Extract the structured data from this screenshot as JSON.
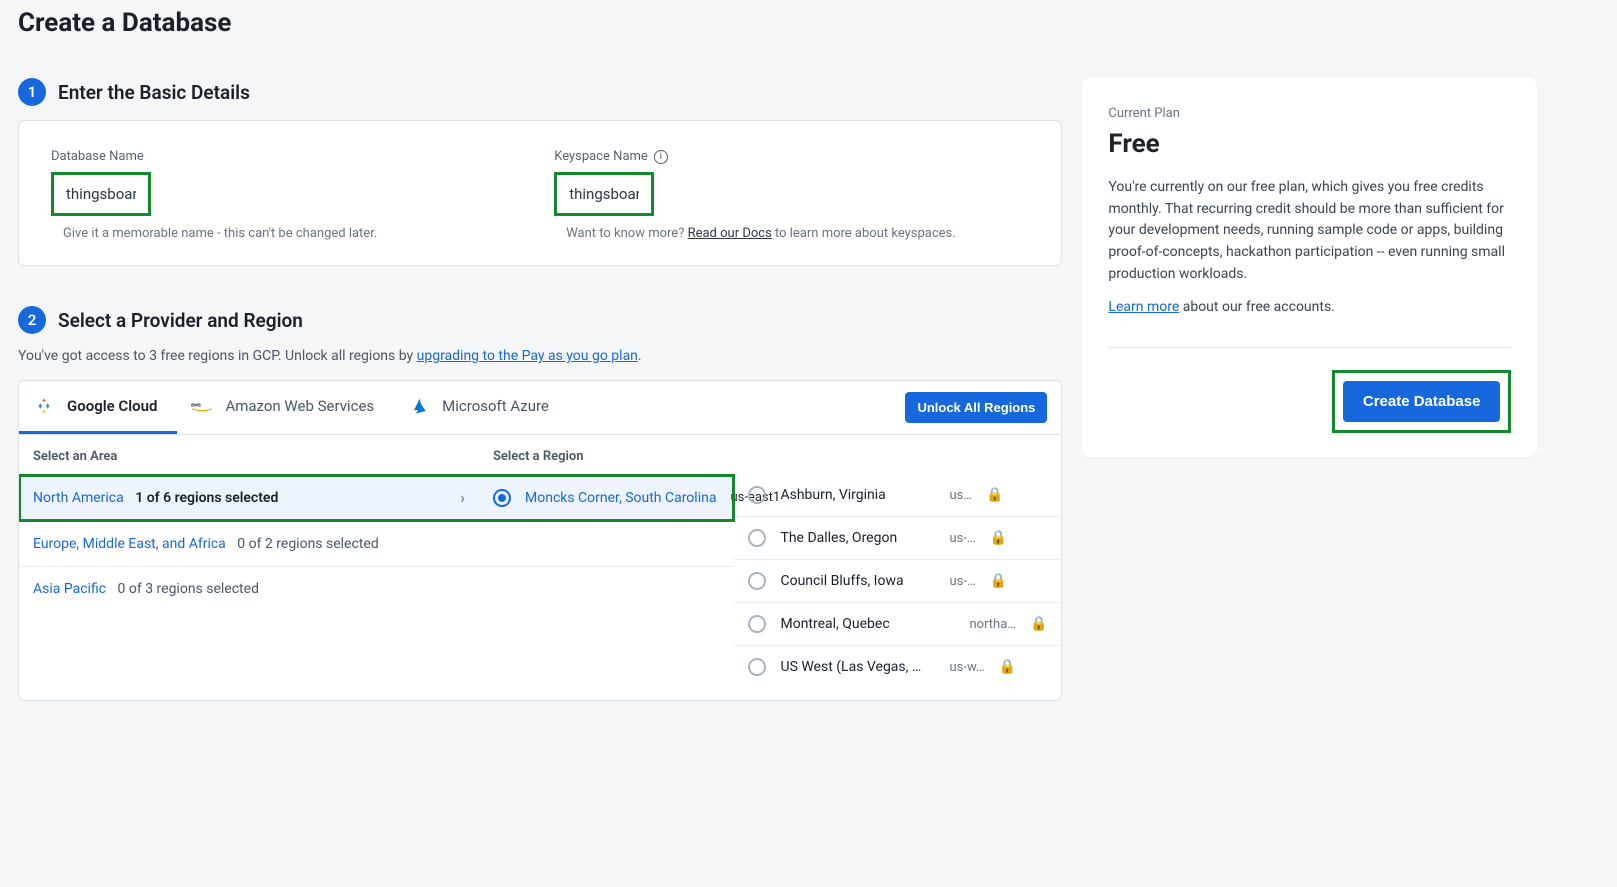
{
  "page": {
    "title": "Create a Database"
  },
  "step1": {
    "badge": "1",
    "title": "Enter the Basic Details",
    "db_name": {
      "label": "Database Name",
      "value": "thingsboard",
      "help": "Give it a memorable name - this can't be changed later."
    },
    "keyspace": {
      "label": "Keyspace Name",
      "value": "thingsboard",
      "help_prefix": "Want to know more? ",
      "help_link": "Read our Docs",
      "help_suffix": " to learn more about keyspaces."
    }
  },
  "step2": {
    "badge": "2",
    "title": "Select a Provider and Region",
    "desc_prefix": "You've got access to 3 free regions in GCP. Unlock all regions by ",
    "desc_link": "upgrading to the Pay as you go plan",
    "desc_suffix": ".",
    "tabs": {
      "gcp": "Google Cloud",
      "aws": "Amazon Web Services",
      "azure": "Microsoft Azure"
    },
    "unlock_button": "Unlock All Regions",
    "col_area": "Select an Area",
    "col_region": "Select a Region",
    "areas": [
      {
        "name": "North America",
        "count": "1 of 6 regions selected",
        "active": true
      },
      {
        "name": "Europe, Middle East, and Africa",
        "count": "0 of 2 regions selected",
        "active": false
      },
      {
        "name": "Asia Pacific",
        "count": "0 of 3 regions selected",
        "active": false
      }
    ],
    "regions": [
      {
        "name": "Moncks Corner, South Carolina",
        "code": "us-east1",
        "locked": false,
        "selected": true
      },
      {
        "name": "Ashburn, Virginia",
        "code": "us…",
        "locked": true,
        "selected": false
      },
      {
        "name": "The Dalles, Oregon",
        "code": "us-…",
        "locked": true,
        "selected": false
      },
      {
        "name": "Council Bluffs, Iowa",
        "code": "us-…",
        "locked": true,
        "selected": false
      },
      {
        "name": "Montreal, Quebec",
        "code": "northa…",
        "locked": true,
        "selected": false
      },
      {
        "name": "US West (Las Vegas, …",
        "code": "us-w…",
        "locked": true,
        "selected": false
      }
    ]
  },
  "plan": {
    "label": "Current Plan",
    "name": "Free",
    "desc": "You're currently on our free plan, which gives you free credits monthly. That recurring credit should be more than sufficient for your development needs, running sample code or apps, building proof-of-concepts, hackathon participation -- even running small production workloads.",
    "learn_link": "Learn more",
    "learn_suffix": " about our free accounts.",
    "create_button": "Create Database"
  }
}
